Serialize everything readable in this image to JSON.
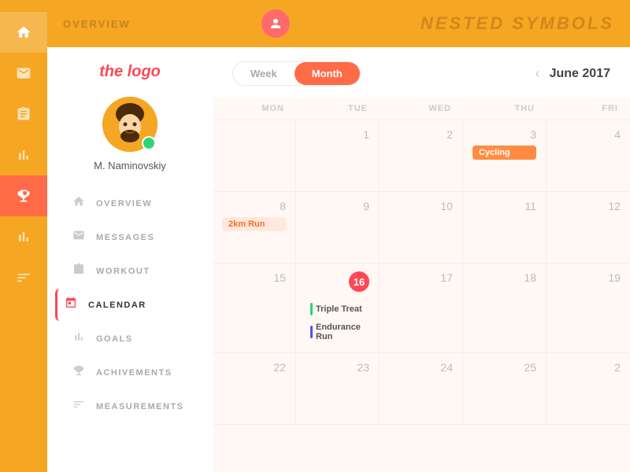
{
  "topBar": {
    "title": "OVERVIEW",
    "appName": "NESTED SYMBOLS"
  },
  "iconBar": {
    "icons": [
      {
        "name": "home-icon",
        "symbol": "⌂",
        "active": false
      },
      {
        "name": "mail-icon",
        "symbol": "✉",
        "active": false
      },
      {
        "name": "clipboard-icon",
        "symbol": "⊞",
        "active": false
      },
      {
        "name": "chart-icon",
        "symbol": "📊",
        "active": false
      },
      {
        "name": "trophy-icon",
        "symbol": "🏆",
        "active": false
      },
      {
        "name": "bar-chart-icon",
        "symbol": "▦",
        "active": false
      },
      {
        "name": "tune-icon",
        "symbol": "≡",
        "active": false
      }
    ]
  },
  "sidebar": {
    "logo": "the logo",
    "username": "M. Naminovskiy",
    "nav": [
      {
        "id": "overview",
        "label": "OVERVIEW",
        "icon": "⌂",
        "active": false
      },
      {
        "id": "messages",
        "label": "MESSAGES",
        "icon": "✉",
        "active": false
      },
      {
        "id": "workout",
        "label": "WORKOUT",
        "icon": "⊞",
        "active": false
      },
      {
        "id": "calendar",
        "label": "CALENDAR",
        "icon": "📅",
        "active": true
      },
      {
        "id": "goals",
        "label": "GOALS",
        "icon": "📊",
        "active": false
      },
      {
        "id": "achievements",
        "label": "ACHIVEMENTS",
        "icon": "🏆",
        "active": false
      },
      {
        "id": "measurements",
        "label": "MEASUREMENTS",
        "icon": "▦",
        "active": false
      }
    ]
  },
  "calendar": {
    "tabs": [
      {
        "id": "week",
        "label": "Week",
        "active": false
      },
      {
        "id": "month",
        "label": "Month",
        "active": true
      }
    ],
    "currentMonth": "June 2017",
    "dayHeaders": [
      "MON",
      "TUE",
      "WED",
      "THU",
      "FRI"
    ],
    "weeks": [
      {
        "days": [
          {
            "date": "",
            "events": []
          },
          {
            "date": "1",
            "events": []
          },
          {
            "date": "2",
            "events": []
          },
          {
            "date": "3",
            "events": [
              {
                "type": "orange",
                "label": "Cycling"
              }
            ]
          },
          {
            "date": "4",
            "events": []
          }
        ]
      },
      {
        "days": [
          {
            "date": "8",
            "events": [
              {
                "type": "orange-light",
                "label": "2km Run"
              }
            ]
          },
          {
            "date": "9",
            "events": []
          },
          {
            "date": "10",
            "events": []
          },
          {
            "date": "11",
            "events": []
          },
          {
            "date": "12",
            "events": []
          }
        ]
      },
      {
        "days": [
          {
            "date": "15",
            "events": []
          },
          {
            "date": "16",
            "today": true,
            "events": [
              {
                "type": "bar-green",
                "label": "Triple Treat"
              },
              {
                "type": "bar-blue",
                "label": "Endurance Run"
              }
            ]
          },
          {
            "date": "17",
            "events": []
          },
          {
            "date": "18",
            "events": []
          },
          {
            "date": "19",
            "events": []
          }
        ]
      },
      {
        "days": [
          {
            "date": "22",
            "events": []
          },
          {
            "date": "23",
            "events": []
          },
          {
            "date": "24",
            "events": []
          },
          {
            "date": "25",
            "events": []
          },
          {
            "date": "2",
            "events": []
          }
        ]
      }
    ]
  }
}
